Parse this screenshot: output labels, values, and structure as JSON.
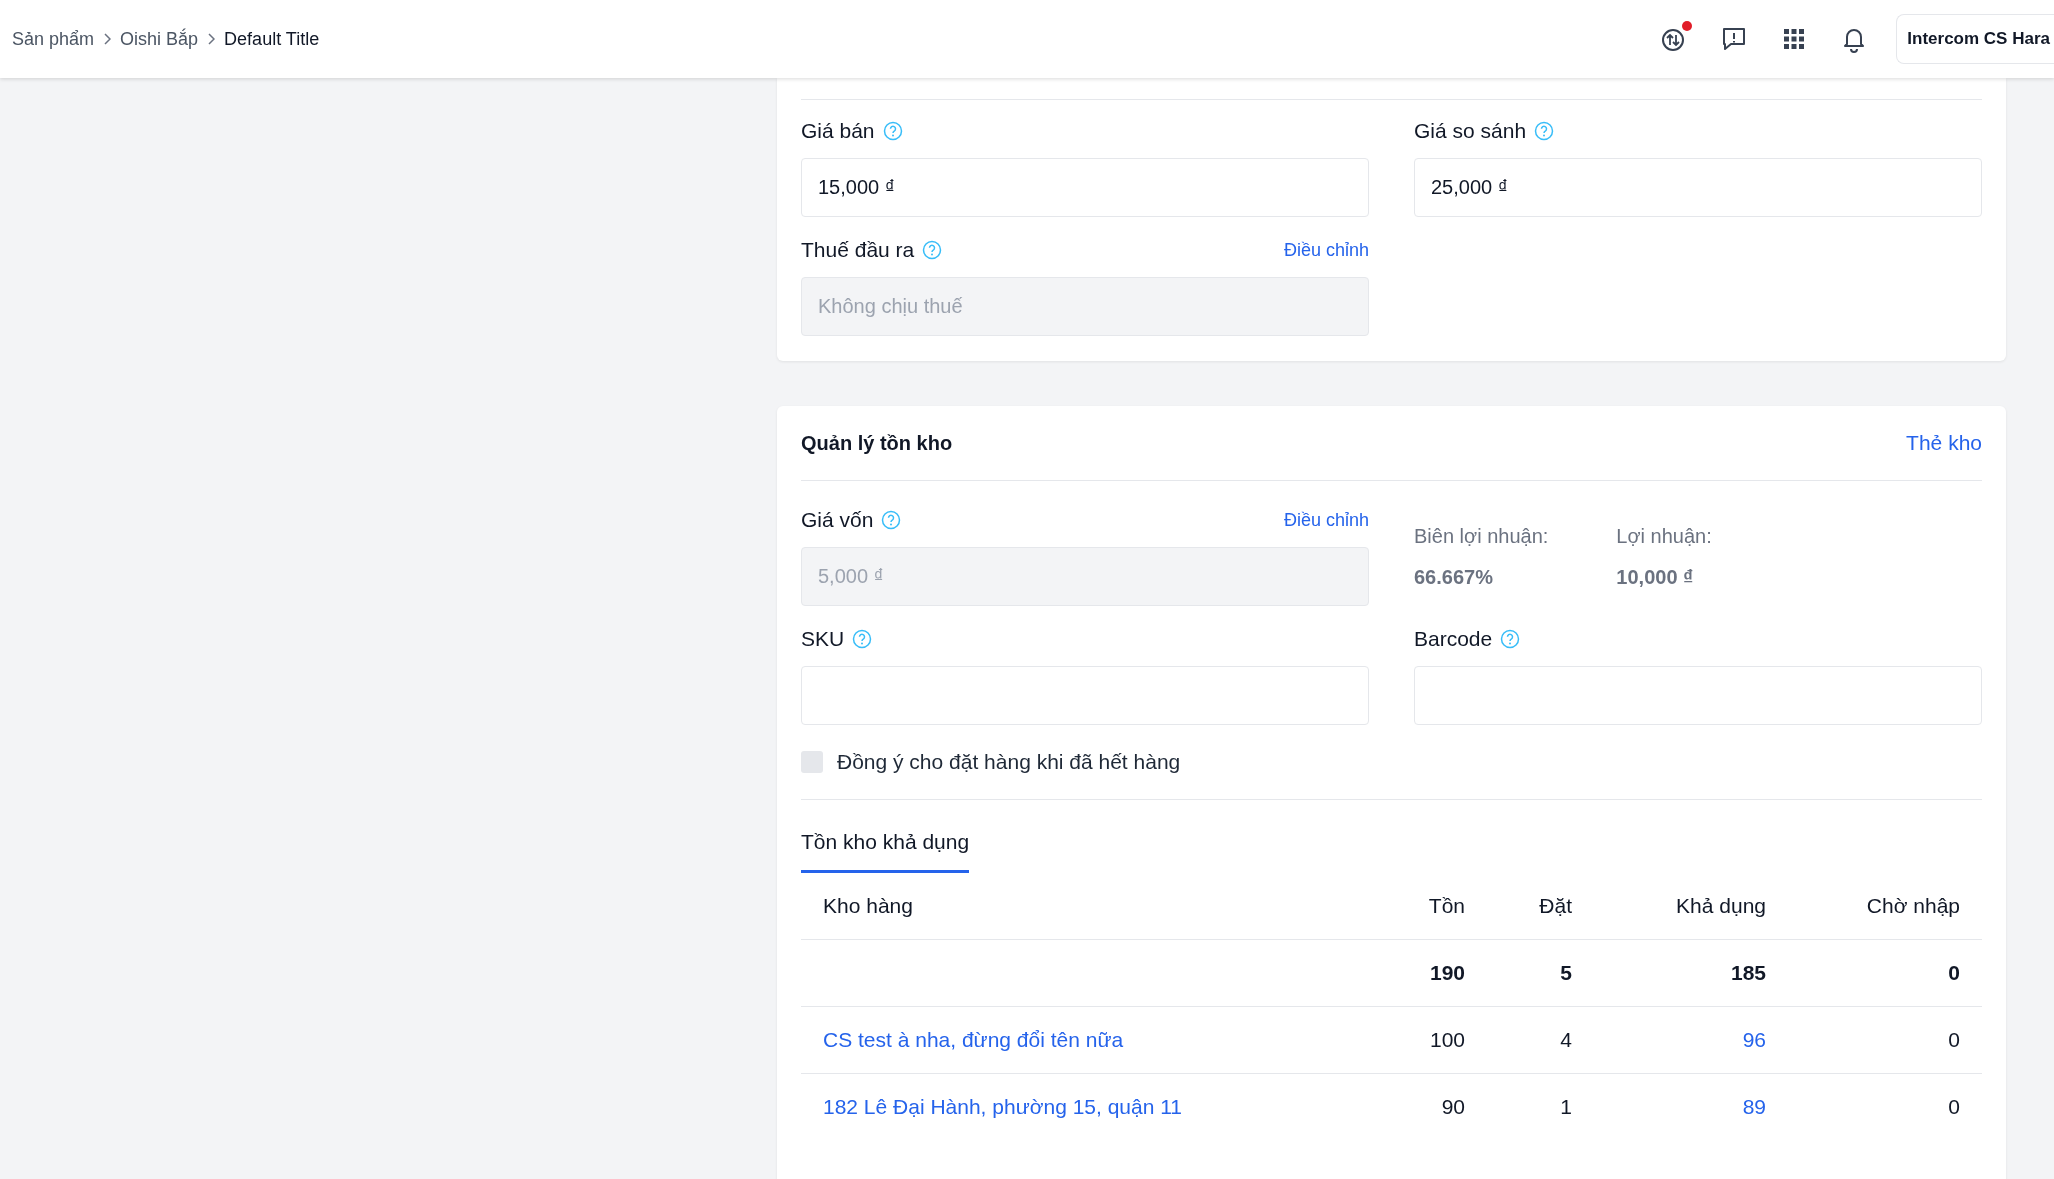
{
  "breadcrumb": [
    {
      "label": "Sản phẩm",
      "current": false
    },
    {
      "label": "Oishi Bắp",
      "current": false
    },
    {
      "label": "Default Title",
      "current": true
    }
  ],
  "topbar": {
    "notification_dot": true,
    "account": "Intercom CS Hara"
  },
  "pricing": {
    "fields": [
      {
        "label": "Giá bán",
        "value": "15,000 ₫",
        "disabled": false
      },
      {
        "label": "Giá so sánh",
        "value": "25,000 ₫",
        "disabled": false
      },
      {
        "label": "Thuế đầu ra",
        "value": "Không chịu thuế",
        "disabled": true,
        "action": "Điều chỉnh"
      }
    ]
  },
  "inventory": {
    "title": "Quản lý tồn kho",
    "link": "Thẻ kho",
    "cost": {
      "label": "Giá vốn",
      "value": "5,000 ₫",
      "disabled": true,
      "action": "Điều chỉnh"
    },
    "stats": [
      {
        "label": "Biên lợi nhuận:",
        "value": "66.667%"
      },
      {
        "label": "Lợi nhuận:",
        "value": "10,000 ₫"
      }
    ],
    "codes": [
      {
        "label": "SKU"
      },
      {
        "label": "Barcode"
      }
    ],
    "backorder": {
      "label": "Đồng ý cho đặt hàng khi đã hết hàng",
      "checked": false
    },
    "tabs": [
      {
        "label": "Tồn kho khả dụng",
        "selected": true
      }
    ],
    "table": {
      "columns": [
        "Kho hàng",
        "Tồn",
        "Đặt",
        "Khả dụng",
        "Chờ nhập"
      ],
      "rows": [
        {
          "kind": "total",
          "cells": [
            "",
            "190",
            "5",
            "185",
            "0"
          ]
        },
        {
          "kind": "warehouse",
          "cells": [
            "CS test à nha, đừng đổi tên nữa",
            "100",
            "4",
            "96",
            "0"
          ]
        },
        {
          "kind": "warehouse",
          "cells": [
            "182 Lê Đại Hành, phường 15, quận 11",
            "90",
            "1",
            "89",
            "0"
          ]
        }
      ]
    }
  }
}
